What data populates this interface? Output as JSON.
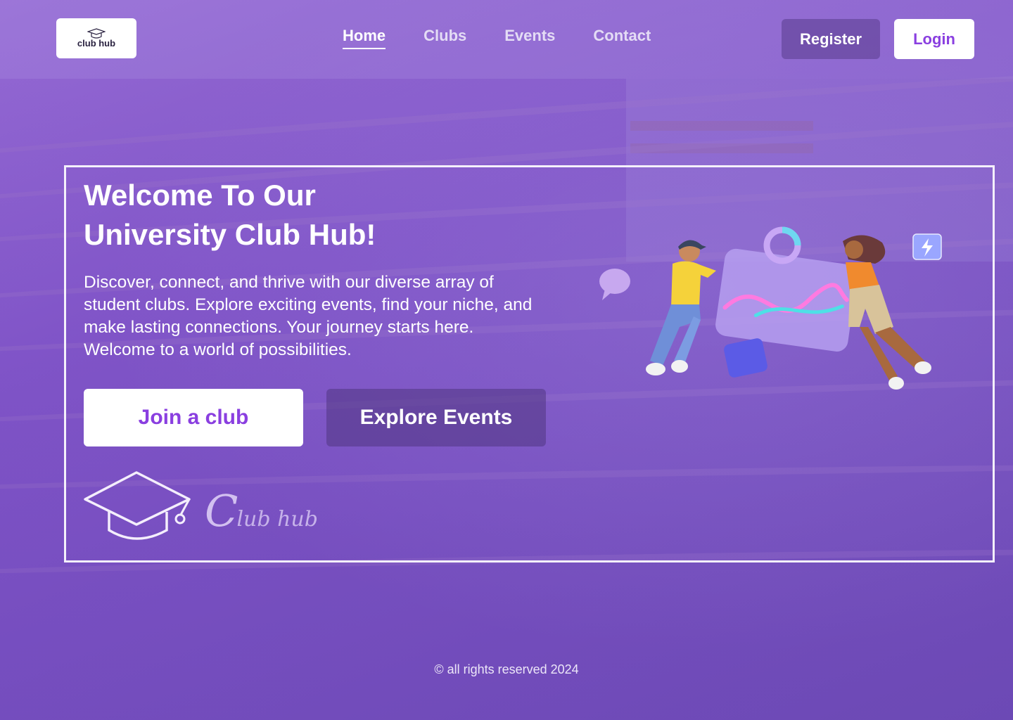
{
  "header": {
    "logo_text": "club hub",
    "nav": [
      {
        "label": "Home",
        "active": true
      },
      {
        "label": "Clubs",
        "active": false
      },
      {
        "label": "Events",
        "active": false
      },
      {
        "label": "Contact",
        "active": false
      }
    ],
    "register_label": "Register",
    "login_label": "Login"
  },
  "hero": {
    "title_line1": "Welcome To Our",
    "title_line2": "University Club Hub!",
    "description": "Discover, connect, and thrive with our diverse array of student clubs. Explore exciting events, find your niche, and make lasting connections. Your journey starts here. Welcome to a world of possibilities.",
    "join_label": "Join a club",
    "explore_label": "Explore Events",
    "logo_script_c": "C",
    "logo_script_rest": "lub hub"
  },
  "footer": {
    "copyright": "© all rights reserved 2024"
  },
  "colors": {
    "accent": "#8a3fe0",
    "background": "#8457c9",
    "white": "#ffffff"
  }
}
